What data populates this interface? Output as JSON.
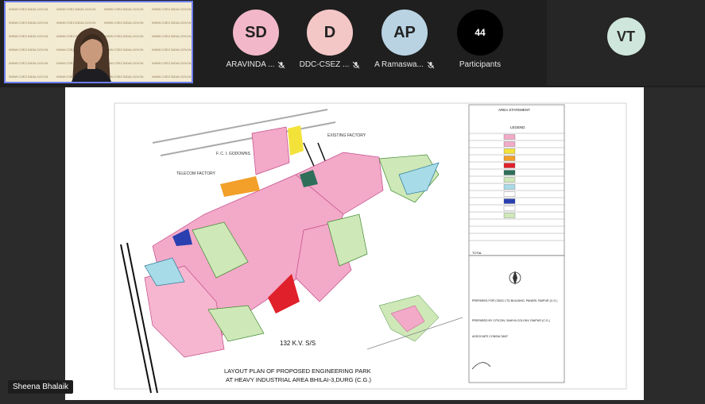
{
  "participants": [
    {
      "initials": "SD",
      "name": "ARAVINDA ...",
      "bg": "#f2b8c9",
      "fg": "#222222"
    },
    {
      "initials": "D",
      "name": "DDC-CSEZ ...",
      "bg": "#f4c7c7",
      "fg": "#222222"
    },
    {
      "initials": "AP",
      "name": "A Ramaswa...",
      "bg": "#b9d3e3",
      "fg": "#222222"
    }
  ],
  "participants_count": {
    "count": "44",
    "label": "Participants"
  },
  "spotlight": {
    "initials": "VT",
    "bg": "#cfe6dc"
  },
  "self_video": {
    "name": "Sheena Bhalaik",
    "watermark": "WWW.CSEZ.INDIA.GOV.IN"
  },
  "plan": {
    "title_line1": "LAYOUT PLAN OF PROPOSED ENGINEERING PARK",
    "title_line2": "AT HEAVY INDUSTRIAL AREA BHILAI-3,DURG (C.G.)",
    "label_fci": "F. C. I. GODOWNS",
    "label_existing": "EXISTING FACTORY",
    "label_telecom": "TELECOM FACTORY",
    "label_substation": "132 K.V. S/S",
    "area_statement": "AREA STATEMENT",
    "legend": "LEGEND",
    "prepared_for": "PREPARED FOR CSIDC LTD BUILDING, PANDRI, RAIPUR (C.G.)",
    "prepared_by": "PREPARED BY CITICON, SAHIYA COLONY, RAIPUR (C.G.)",
    "associate": "ASSOCIATE CONSULTANT",
    "total": "TOTAL"
  }
}
